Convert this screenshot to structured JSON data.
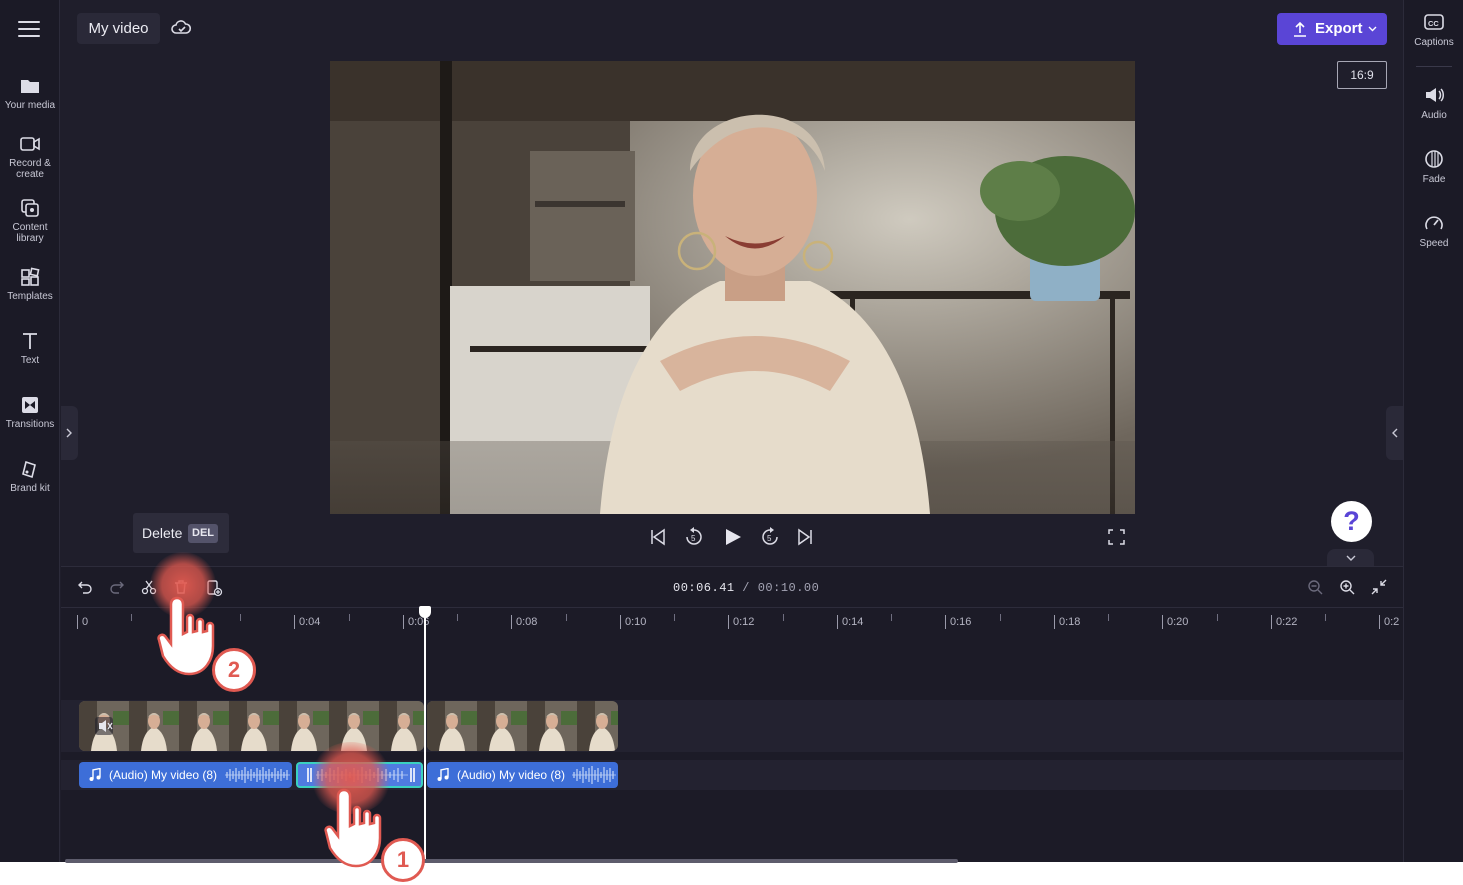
{
  "header": {
    "menu_icon": "hamburger-icon",
    "project_title": "My video",
    "cloud_icon": "cloud-sync-icon",
    "export_label": "Export",
    "accent": "#5a45d6"
  },
  "left_sidebar": {
    "items": [
      {
        "label": "Your media",
        "icon": "folder-icon"
      },
      {
        "label": "Record & create",
        "icon": "camera-icon"
      },
      {
        "label": "Content library",
        "icon": "library-icon"
      },
      {
        "label": "Templates",
        "icon": "templates-icon"
      },
      {
        "label": "Text",
        "icon": "text-icon"
      },
      {
        "label": "Transitions",
        "icon": "transitions-icon"
      },
      {
        "label": "Brand kit",
        "icon": "brand-kit-icon"
      }
    ]
  },
  "right_sidebar": {
    "items": [
      {
        "label": "Captions",
        "icon": "captions-icon"
      },
      {
        "label": "Audio",
        "icon": "speaker-icon"
      },
      {
        "label": "Fade",
        "icon": "fade-icon"
      },
      {
        "label": "Speed",
        "icon": "speedometer-icon"
      }
    ]
  },
  "preview": {
    "aspect_ratio": "16:9",
    "help_label": "?"
  },
  "tooltip": {
    "label": "Delete",
    "shortcut": "DEL"
  },
  "timeline": {
    "current_time": "00:06.41",
    "separator": " / ",
    "total_time": "00:10.00",
    "ruler_labels": [
      "0",
      "0:04",
      "0:06",
      "0:08",
      "0:10",
      "0:12",
      "0:14",
      "0:16",
      "0:18",
      "0:20",
      "0:22",
      "0:2"
    ],
    "audio_clips": [
      {
        "label": "(Audio) My video (8)"
      },
      {
        "label": "(Audio) My video (8)"
      }
    ],
    "clip_colors": {
      "audio": "#3d6ed8",
      "selected_outline": "#3ad0c0"
    }
  },
  "tutorial": {
    "step1": "1",
    "step2": "2",
    "marker_color": "#e05a52"
  }
}
